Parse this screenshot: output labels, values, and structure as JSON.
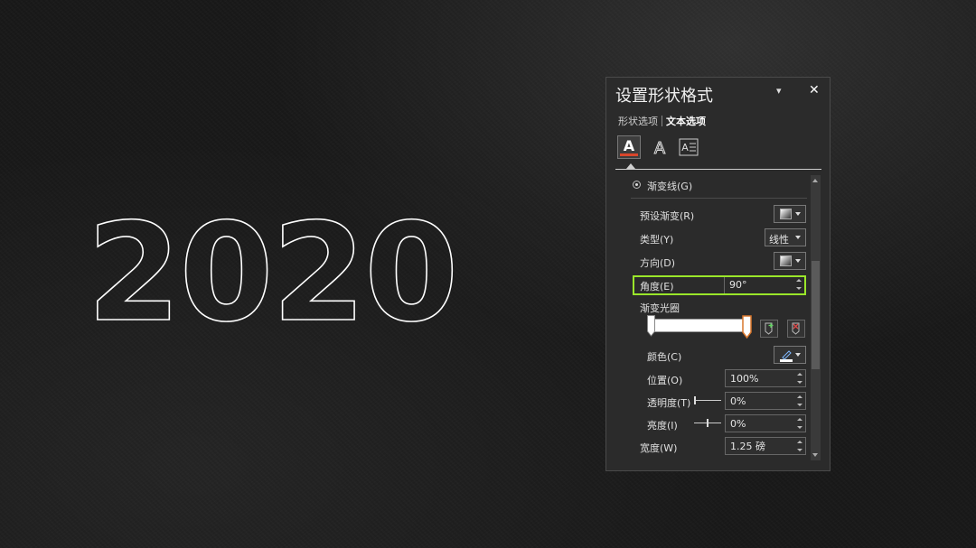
{
  "artwork": {
    "year_text": "2020"
  },
  "panel": {
    "title": "设置形状格式",
    "menu_glyph": "▾",
    "close_glyph": "✕",
    "tabs": [
      {
        "label": "形状选项",
        "active": false
      },
      {
        "label": "文本选项",
        "active": true
      }
    ],
    "icons": [
      "text-fill-outline-icon",
      "text-effects-icon",
      "textbox-icon"
    ],
    "gradient_line_label": "渐变线(G)",
    "preset_label": "预设渐变(R)",
    "type_label": "类型(Y)",
    "type_value": "线性",
    "direction_label": "方向(D)",
    "angle_label": "角度(E)",
    "angle_value": "90°",
    "stops_label": "渐变光圈",
    "color_label": "颜色(C)",
    "position_label": "位置(O)",
    "position_value": "100%",
    "transparency_label": "透明度(T)",
    "transparency_value": "0%",
    "brightness_label": "亮度(I)",
    "brightness_value": "0%",
    "width_label": "宽度(W)",
    "width_value": "1.25 磅",
    "highlight_color": "#9ae62a",
    "stop_selected_color": "#d9762b"
  }
}
